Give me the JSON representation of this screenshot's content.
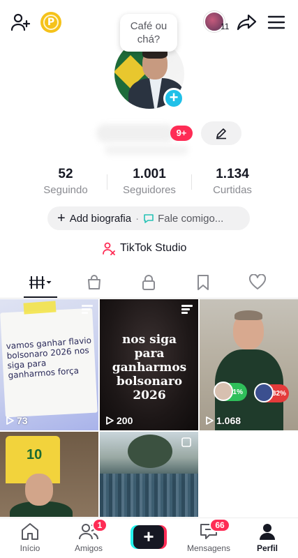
{
  "topbar": {
    "coin_label": "P",
    "story_count": "11"
  },
  "bubble": {
    "line1": "Café ou",
    "line2": "chá?"
  },
  "profile": {
    "notification_badge": "9+"
  },
  "stats": [
    {
      "value": "52",
      "label": "Seguindo"
    },
    {
      "value": "1.001",
      "label": "Seguidores"
    },
    {
      "value": "1.134",
      "label": "Curtidas"
    }
  ],
  "bio": {
    "add_label": "Add biografia",
    "separator": "·",
    "fale_label": "Fale comigo..."
  },
  "studio": {
    "label": "TikTok Studio"
  },
  "tabs": [
    {
      "name": "videos-grid-icon",
      "active": true
    },
    {
      "name": "shop-bag-icon",
      "active": false
    },
    {
      "name": "lock-icon",
      "active": false
    },
    {
      "name": "bookmark-icon",
      "active": false
    },
    {
      "name": "heart-icon",
      "active": false
    }
  ],
  "videos": [
    {
      "views": "73",
      "text": "vamos ganhar flavio bolsonaro 2026 nos siga para ganharmos força"
    },
    {
      "views": "200",
      "text": "nos siga para ganharmos bolsonaro 2026"
    },
    {
      "views": "1.068",
      "badge_a": "61%",
      "badge_b": "32%"
    },
    {
      "views": "",
      "jersey_number": "10"
    },
    {
      "views": ""
    }
  ],
  "bottom_nav": {
    "home": "Início",
    "friends": "Amigos",
    "friends_badge": "1",
    "inbox": "Mensagens",
    "inbox_badge": "66",
    "profile": "Perfil",
    "create": "+"
  },
  "colors": {
    "accent": "#fe2c55",
    "cyan": "#25f4ee",
    "blue_plus": "#20c0e8",
    "coin": "#f5c21a"
  }
}
